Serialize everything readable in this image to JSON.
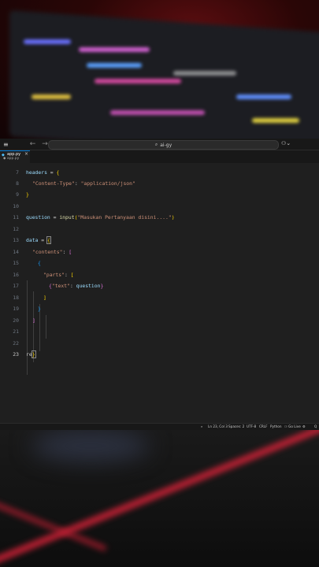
{
  "titlebar": {
    "menu_icon": "menu-icon",
    "back_arrow": "←",
    "forward_arrow": "→",
    "search_icon": "⌕",
    "search_text": "ai-gy",
    "copilot_icon": "⚇⌄"
  },
  "tab": {
    "icon": "◆",
    "label": "app.py",
    "close": "×",
    "breadcrumb": "◆ app.py"
  },
  "code_lines": [
    {
      "num": "7",
      "text": "headers = {"
    },
    {
      "num": "8",
      "text": "\"Content-Type\": \"application/json\""
    },
    {
      "num": "9",
      "text": "}"
    },
    {
      "num": "10",
      "text": ""
    },
    {
      "num": "11",
      "text": "question = input(\"Masukan Pertanyaan disini....\")"
    },
    {
      "num": "12",
      "text": ""
    },
    {
      "num": "13",
      "text": "data = {"
    },
    {
      "num": "14",
      "text": "\"contents\": ["
    },
    {
      "num": "15",
      "text": "{"
    },
    {
      "num": "16",
      "text": "\"parts\": ["
    },
    {
      "num": "17",
      "text": "{\"text\": question}"
    },
    {
      "num": "18",
      "text": "]"
    },
    {
      "num": "19",
      "text": "}"
    },
    {
      "num": "20",
      "text": "]"
    },
    {
      "num": "21",
      "text": ""
    },
    {
      "num": "22",
      "text": ""
    },
    {
      "num": "23",
      "text": "re}"
    }
  ],
  "code": {
    "l7_var": "headers",
    "l7_op": " = ",
    "l7_brace": "{",
    "l8_key": "\"Content-Type\"",
    "l8_colon": ": ",
    "l8_val": "\"application/json\"",
    "l9_brace": "}",
    "l11_var": "question",
    "l11_op": " = ",
    "l11_fn": "input",
    "l11_open": "(",
    "l11_str": "\"Masukan Pertanyaan disini....\"",
    "l11_close": ")",
    "l13_var": "data",
    "l13_op": " = ",
    "l13_brace": "{",
    "l14_key": "\"contents\"",
    "l14_colon": ": ",
    "l14_bracket": "[",
    "l15_brace": "{",
    "l16_key": "\"parts\"",
    "l16_colon": ": ",
    "l16_bracket": "[",
    "l17_open": "{",
    "l17_key": "\"text\"",
    "l17_colon": ": ",
    "l17_var": "question",
    "l17_close": "}",
    "l18_bracket": "]",
    "l19_brace": "}",
    "l20_bracket": "]",
    "l23_text": "re",
    "l23_brace": "}"
  },
  "statusbar": {
    "zoom_icon": "🔍",
    "position": "Ln 23, Col 3",
    "spaces": "Spaces: 2",
    "encoding": "UTF-8",
    "eol": "CRLF",
    "language": "Python",
    "golive": "⚆ Go Live",
    "extra1": "⚙",
    "extra2": "Q"
  },
  "colors": {
    "editor_bg": "#1f1f1f",
    "variable": "#9cdcfe",
    "string": "#ce9178",
    "function": "#dcdcaa",
    "bracket_gold": "#ffd700",
    "bracket_purple": "#da70d6",
    "bracket_blue": "#179fff"
  }
}
